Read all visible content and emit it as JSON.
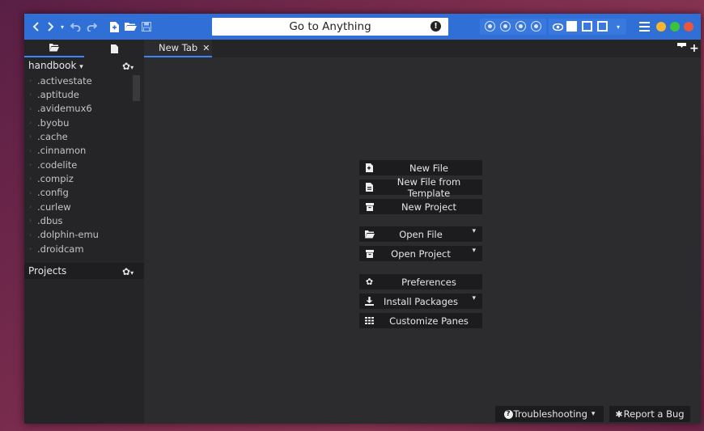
{
  "toolbar": {
    "goto_placeholder": "Go to Anything",
    "goto_badge": "!",
    "accent": "#2f6fd6",
    "icons": [
      "back-icon",
      "forward-icon",
      "history-dropdown-icon",
      "undo-icon",
      "redo-icon",
      "new-file-icon",
      "open-folder-icon",
      "save-icon",
      "record-icon",
      "stop-icon",
      "play-icon",
      "macro-icon",
      "preview-icon",
      "left-pane-icon",
      "bottom-pane-icon",
      "right-pane-icon",
      "pane-dropdown-icon",
      "menu-icon"
    ],
    "window_controls": {
      "minimize": "#f5b72f",
      "maximize": "#3ec23e",
      "close": "#e9573f"
    }
  },
  "sidebar": {
    "tabs": [
      "places-tab",
      "projects-file-tab"
    ],
    "place_title": "handbook",
    "place_caret": "▾",
    "gear_caret": "▾",
    "files": [
      ".activestate",
      ".aptitude",
      ".avidemux6",
      ".byobu",
      ".cache",
      ".cinnamon",
      ".codelite",
      ".compiz",
      ".config",
      ".curlew",
      ".dbus",
      ".dolphin-emu",
      ".droidcam"
    ],
    "projects_title": "Projects"
  },
  "tabbar": {
    "tab_label": "New Tab",
    "tab_close": "✕"
  },
  "quickstart": {
    "new_file": "New File",
    "new_from_template": "New File from Template",
    "new_project": "New Project",
    "open_file": "Open File",
    "open_project": "Open Project",
    "preferences": "Preferences",
    "install_packages": "Install Packages",
    "customize_panes": "Customize Panes",
    "caret": "▾"
  },
  "footer": {
    "troubleshooting": "Troubleshooting",
    "troubleshooting_caret": "▾",
    "report_bug": "Report a Bug"
  }
}
